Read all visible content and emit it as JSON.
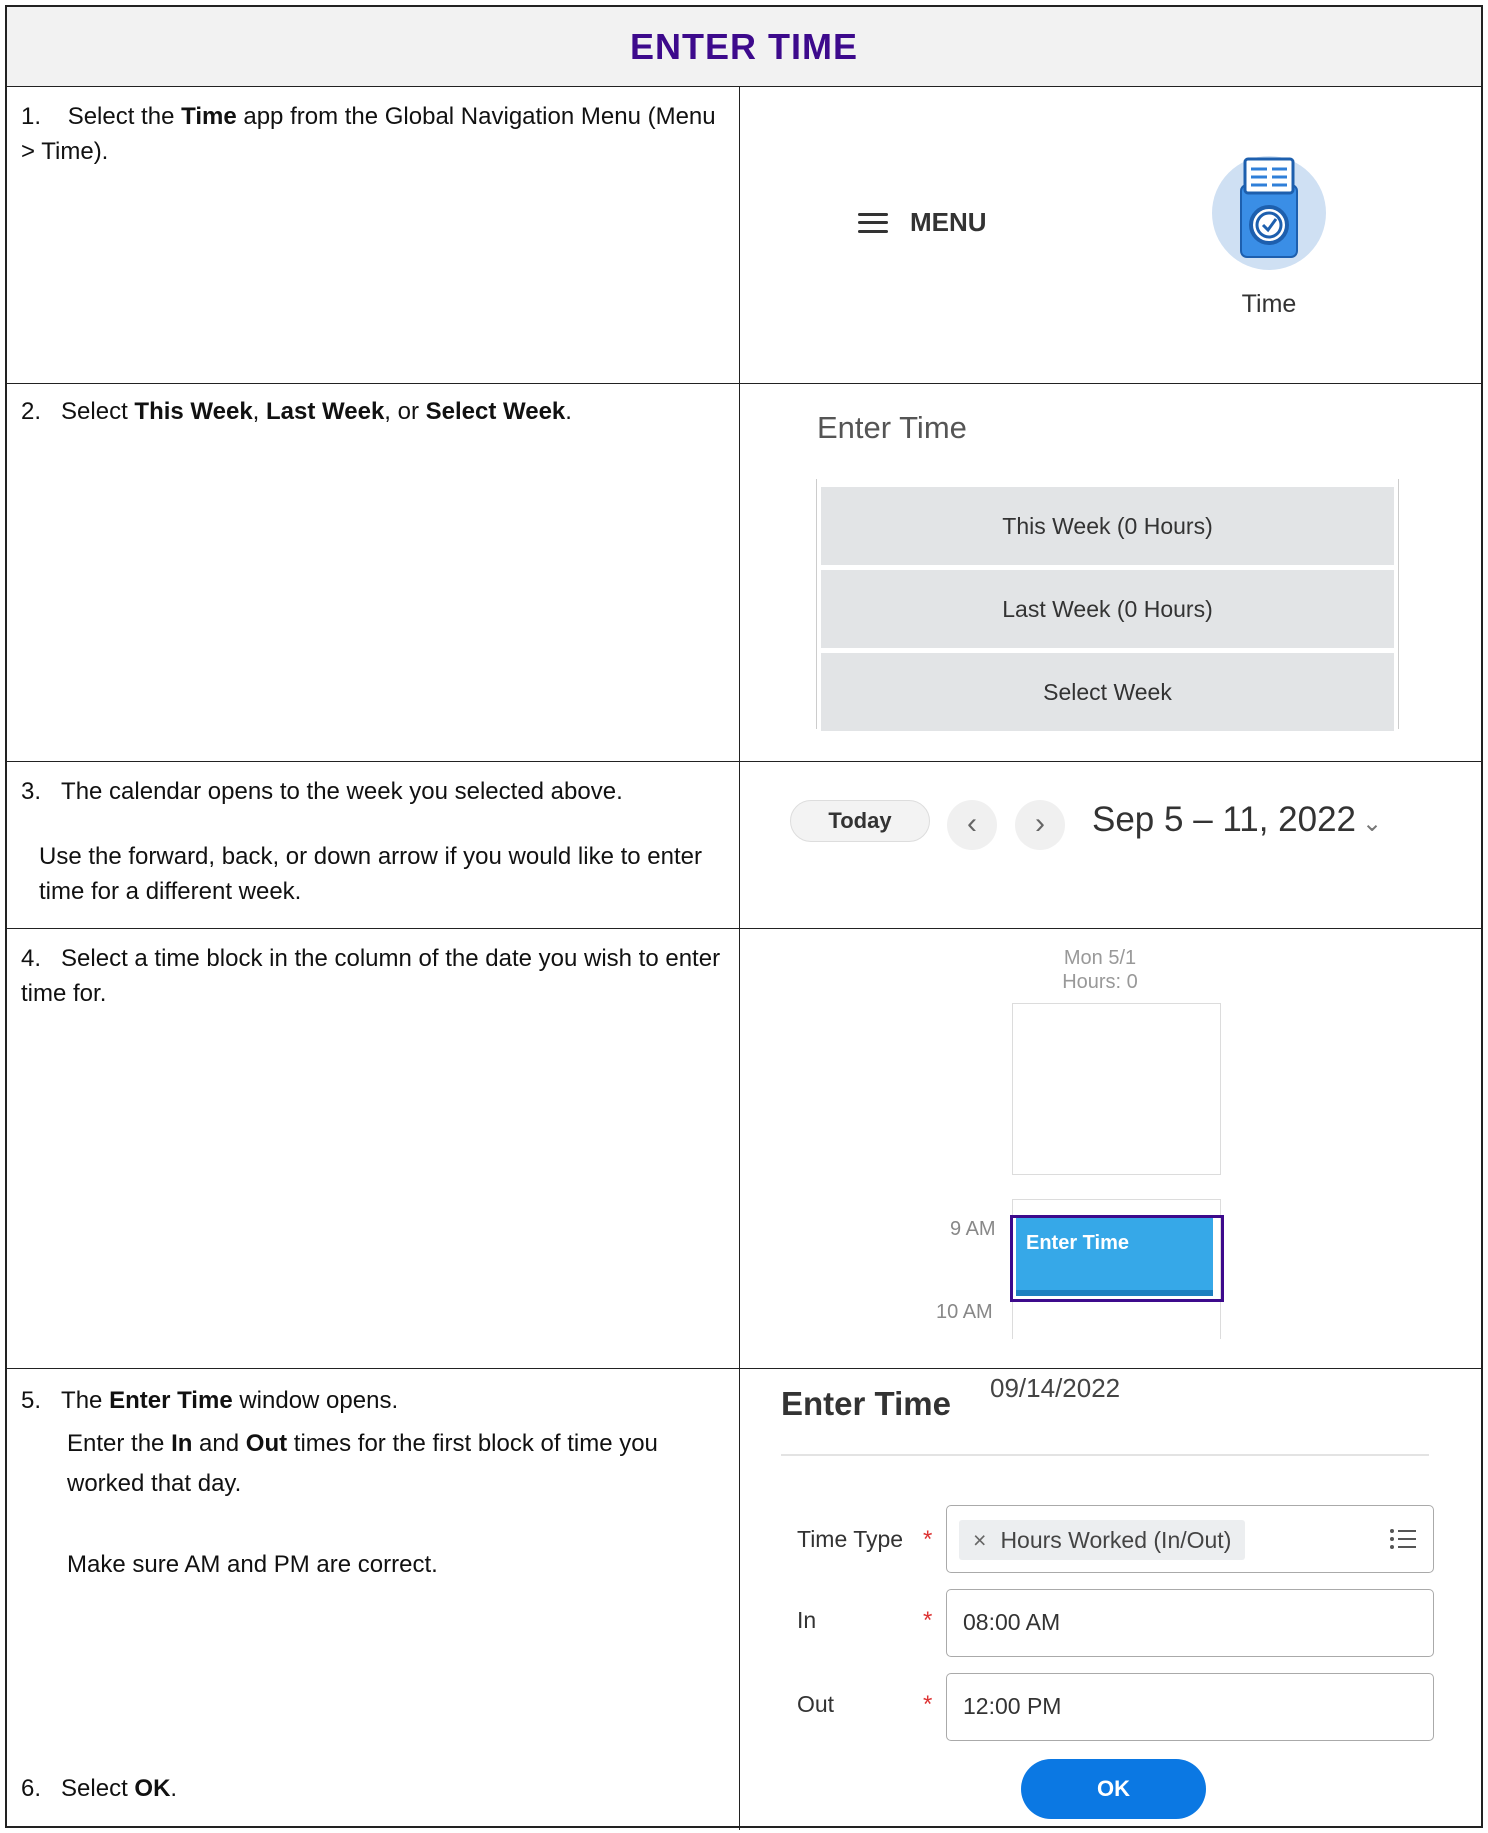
{
  "header": {
    "title": "ENTER TIME"
  },
  "steps": [
    {
      "number": "1.",
      "parts": [
        "Select the ",
        "Time",
        " app from the Global Navigation Menu (Menu > Time)."
      ],
      "menu_label": "MENU",
      "app_icon": "time-clock-icon",
      "app_label": "Time"
    },
    {
      "number": "2.",
      "parts": [
        "Select ",
        "This Week",
        ", ",
        "Last Week",
        ", or ",
        "Select Week",
        "."
      ],
      "panel_title": "Enter Time",
      "buttons": [
        "This Week (0 Hours)",
        "Last Week (0 Hours)",
        "Select Week"
      ]
    },
    {
      "number": "3.",
      "line1": "The calendar opens to the week you selected above.",
      "line2": "Use the forward, back, or down arrow if you would like to enter time for a different week.",
      "today_label": "Today",
      "prev_icon": "chevron-left-icon",
      "next_icon": "chevron-right-icon",
      "range": "Sep 5 – 11, 2022",
      "dropdown_icon": "chevron-down-icon"
    },
    {
      "number": "4.",
      "text": "Select a time block in the column of the date you wish to enter time for.",
      "day_label": "Mon 5/1",
      "hours_label": "Hours: 0",
      "hour_9": "9 AM",
      "hour_10": "10 AM",
      "block_label": "Enter Time"
    },
    {
      "number": "5.",
      "parts_a": [
        "The ",
        "Enter Time",
        " window opens."
      ],
      "parts_b": [
        "Enter the ",
        "In",
        " and ",
        "Out",
        " times for the first block of time you worked that day."
      ],
      "note": "Make sure AM and PM are correct.",
      "form_title": "Enter Time",
      "form_date": "09/14/2022",
      "fields": [
        {
          "label": "Time Type",
          "value": "Hours Worked (In/Out)",
          "required_mark": "*"
        },
        {
          "label": "In",
          "value": "08:00 AM",
          "required_mark": "*"
        },
        {
          "label": "Out",
          "value": "12:00 PM",
          "required_mark": "*"
        }
      ],
      "chip_remove": "×",
      "ok_label": "OK"
    },
    {
      "number": "6.",
      "parts": [
        "Select ",
        "OK",
        "."
      ]
    }
  ],
  "colors": {
    "title": "#3d0a8c",
    "highlight": "#3d0a8c",
    "ok_button": "#0b78e3",
    "block": "#36a8e8",
    "required": "#dd3333"
  }
}
